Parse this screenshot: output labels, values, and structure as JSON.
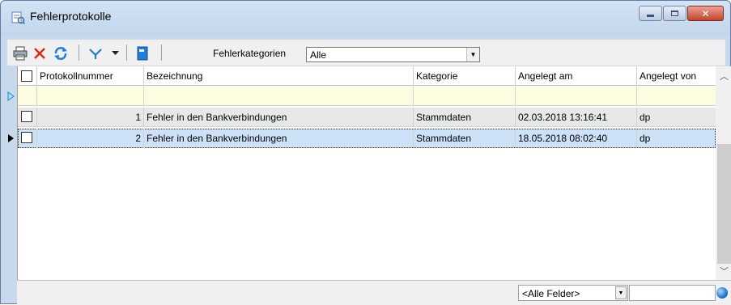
{
  "window": {
    "title": "Fehlerprotokolle",
    "minimize_label": "",
    "maximize_label": ""
  },
  "toolbar": {
    "icons": [
      "print-icon",
      "delete-icon",
      "refresh-icon",
      "filter-icon",
      "dropdown-icon",
      "book-icon"
    ],
    "category_label": "Fehlerkategorien",
    "category_value": "Alle"
  },
  "grid": {
    "columns": [
      "Protokollnummer",
      "Bezeichnung",
      "Kategorie",
      "Angelegt am",
      "Angelegt von"
    ],
    "rows": [
      {
        "nr": "1",
        "bezeichnung": "Fehler in den Bankverbindungen",
        "kategorie": "Stammdaten",
        "angelegt_am": "02.03.2018 13:16:41",
        "angelegt_von": "dp"
      },
      {
        "nr": "2",
        "bezeichnung": "Fehler in den Bankverbindungen",
        "kategorie": "Stammdaten",
        "angelegt_am": "18.05.2018 08:02:40",
        "angelegt_von": "dp"
      }
    ]
  },
  "statusbar": {
    "field_filter": "<Alle Felder>",
    "search_value": ""
  },
  "colors": {
    "selected_row": "#cde2f7",
    "new_row": "#fdfbe0",
    "alt_row": "#e8e8e8",
    "titlebar": "#c9d9ec"
  }
}
